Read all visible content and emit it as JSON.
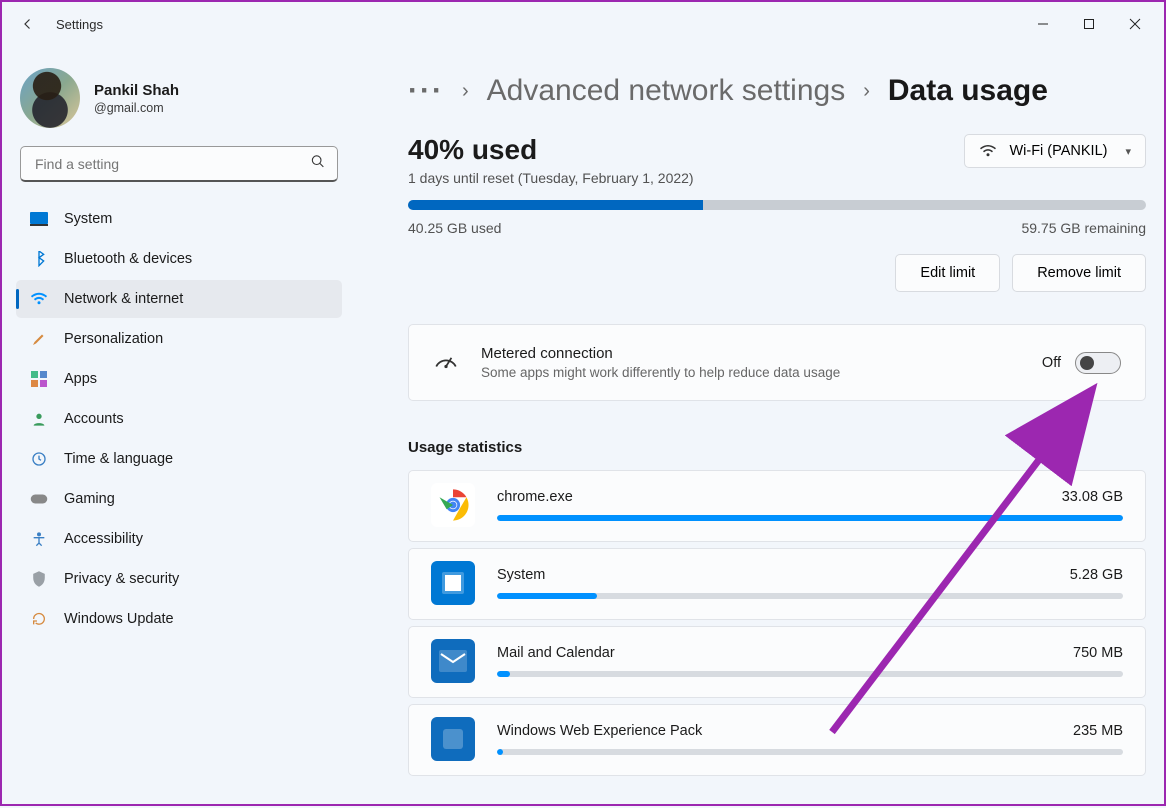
{
  "window": {
    "title": "Settings"
  },
  "user": {
    "name": "Pankil Shah",
    "email": "@gmail.com"
  },
  "search": {
    "placeholder": "Find a setting"
  },
  "nav": {
    "items": [
      {
        "label": "System"
      },
      {
        "label": "Bluetooth & devices"
      },
      {
        "label": "Network & internet"
      },
      {
        "label": "Personalization"
      },
      {
        "label": "Apps"
      },
      {
        "label": "Accounts"
      },
      {
        "label": "Time & language"
      },
      {
        "label": "Gaming"
      },
      {
        "label": "Accessibility"
      },
      {
        "label": "Privacy & security"
      },
      {
        "label": "Windows Update"
      }
    ],
    "active_index": 2
  },
  "breadcrumb": {
    "parent": "Advanced network settings",
    "current": "Data usage"
  },
  "usage": {
    "percent_label": "40% used",
    "reset_text": "1 days until reset (Tuesday, February 1, 2022)",
    "wifi_label": "Wi-Fi (PANKIL)",
    "progress_pct": 40,
    "used_label": "40.25 GB used",
    "remaining_label": "59.75 GB remaining",
    "edit_btn": "Edit limit",
    "remove_btn": "Remove limit"
  },
  "metered": {
    "title": "Metered connection",
    "subtitle": "Some apps might work differently to help reduce data usage",
    "state": "Off"
  },
  "stats": {
    "heading": "Usage statistics",
    "items": [
      {
        "name": "chrome.exe",
        "size": "33.08 GB",
        "pct": 100,
        "icon": "chrome"
      },
      {
        "name": "System",
        "size": "5.28 GB",
        "pct": 16,
        "icon": "system"
      },
      {
        "name": "Mail and Calendar",
        "size": "750 MB",
        "pct": 2,
        "icon": "mail"
      },
      {
        "name": "Windows Web Experience Pack",
        "size": "235 MB",
        "pct": 1,
        "icon": "web"
      }
    ]
  },
  "annotation": {
    "color": "#9c27b0"
  }
}
